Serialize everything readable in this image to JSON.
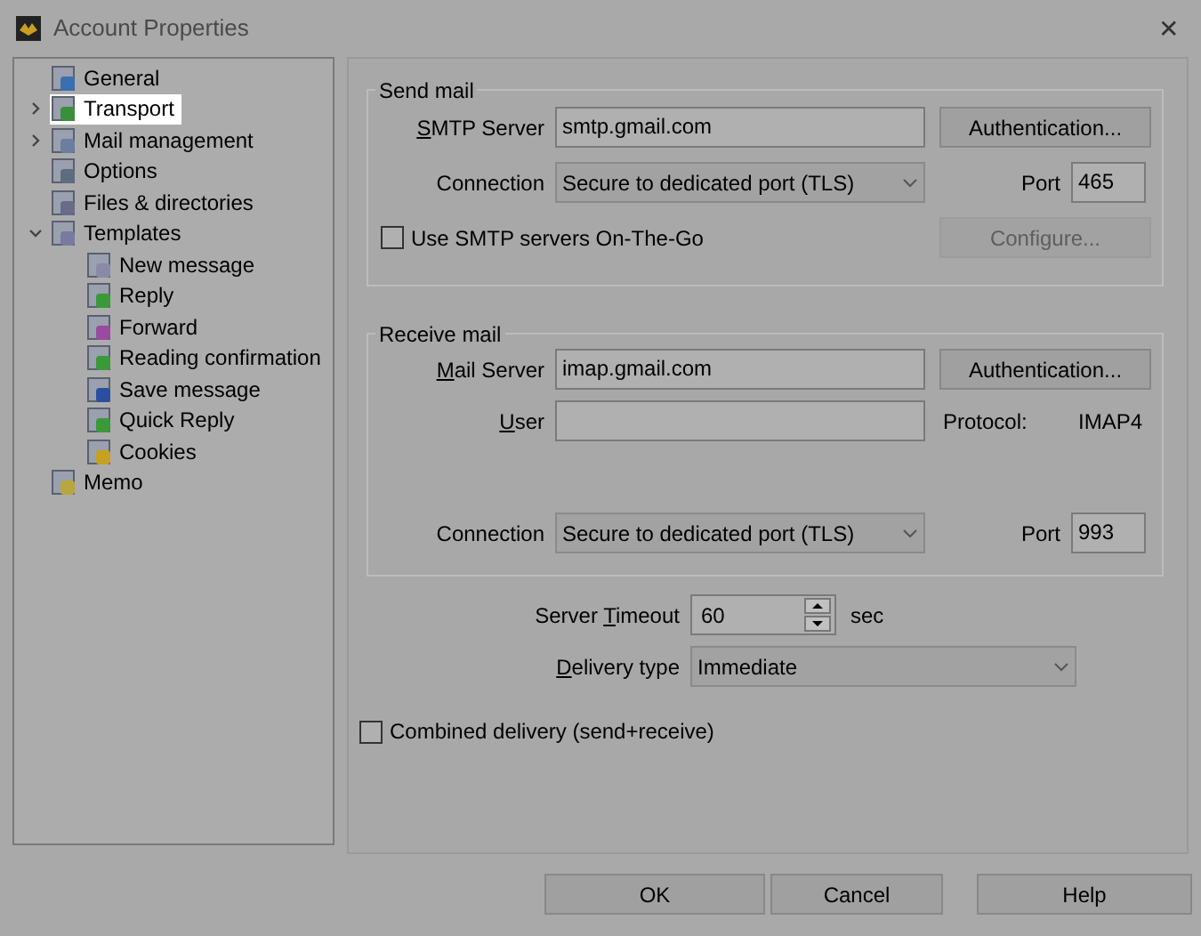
{
  "window": {
    "title": "Account Properties",
    "close": "✕"
  },
  "tree": [
    {
      "label": "General",
      "selected": false
    },
    {
      "label": "Transport",
      "selected": true,
      "expanded": false
    },
    {
      "label": "Mail management",
      "selected": false,
      "expanded": false
    },
    {
      "label": "Options",
      "selected": false
    },
    {
      "label": "Files & directories",
      "selected": false
    },
    {
      "label": "Templates",
      "selected": false,
      "expanded": true,
      "children": [
        {
          "label": "New message",
          "selected": false
        },
        {
          "label": "Reply",
          "selected": false
        },
        {
          "label": "Forward",
          "selected": false
        },
        {
          "label": "Reading confirmation",
          "selected": false
        },
        {
          "label": "Save message",
          "selected": false
        },
        {
          "label": "Quick Reply",
          "selected": false
        },
        {
          "label": "Cookies",
          "selected": false
        }
      ]
    },
    {
      "label": "Memo",
      "selected": false
    }
  ],
  "send_mail": {
    "title": "Send mail",
    "server_label": {
      "key": "S",
      "after": "MTP Server"
    },
    "server": "smtp.gmail.com",
    "auth_button": "Authentication...",
    "connection_label": "Connection",
    "connection": "Secure to dedicated port (TLS)",
    "port_label": "Port",
    "port": "465",
    "on_the_go": {
      "label": "Use SMTP servers On-The-Go",
      "checked": false
    },
    "configure_button": {
      "label": "Configure...",
      "disabled": true
    }
  },
  "receive_mail": {
    "title": "Receive mail",
    "server_label": {
      "key": "M",
      "after": "ail Server"
    },
    "server": "imap.gmail.com",
    "auth_button": "Authentication...",
    "user_label": {
      "key": "U",
      "after": "ser"
    },
    "protocol_label": "Protocol:",
    "protocol": "IMAP4",
    "connection_label": "Connection",
    "connection": "Secure to dedicated port (TLS)",
    "port_label": "Port",
    "port": "993"
  },
  "timeout": {
    "label": {
      "before": "Server ",
      "key": "T",
      "after": "imeout"
    },
    "value": "60",
    "unit": "sec"
  },
  "delivery": {
    "label": {
      "key": "D",
      "after": "elivery type"
    },
    "value": "Immediate"
  },
  "combined": {
    "label": "Combined delivery (send+receive)",
    "checked": false
  },
  "buttons": [
    "OK",
    "Cancel",
    "Help"
  ]
}
